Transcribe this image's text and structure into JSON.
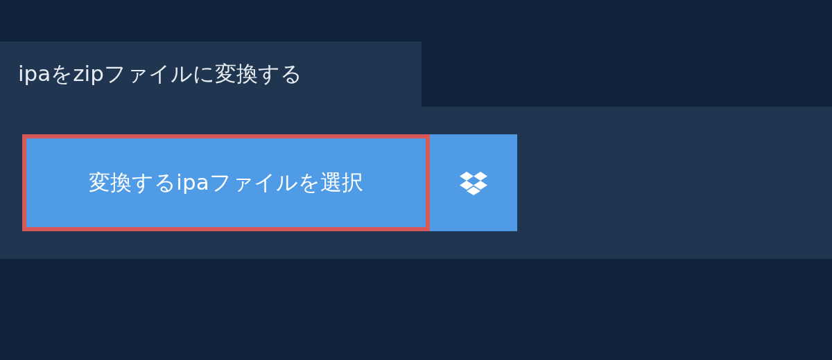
{
  "tab": {
    "title": "ipaをzipファイルに変換する"
  },
  "select_button": {
    "label": "変換するipaファイルを選択",
    "focused": true
  },
  "dropbox_button": {
    "kind": "dropbox"
  }
}
